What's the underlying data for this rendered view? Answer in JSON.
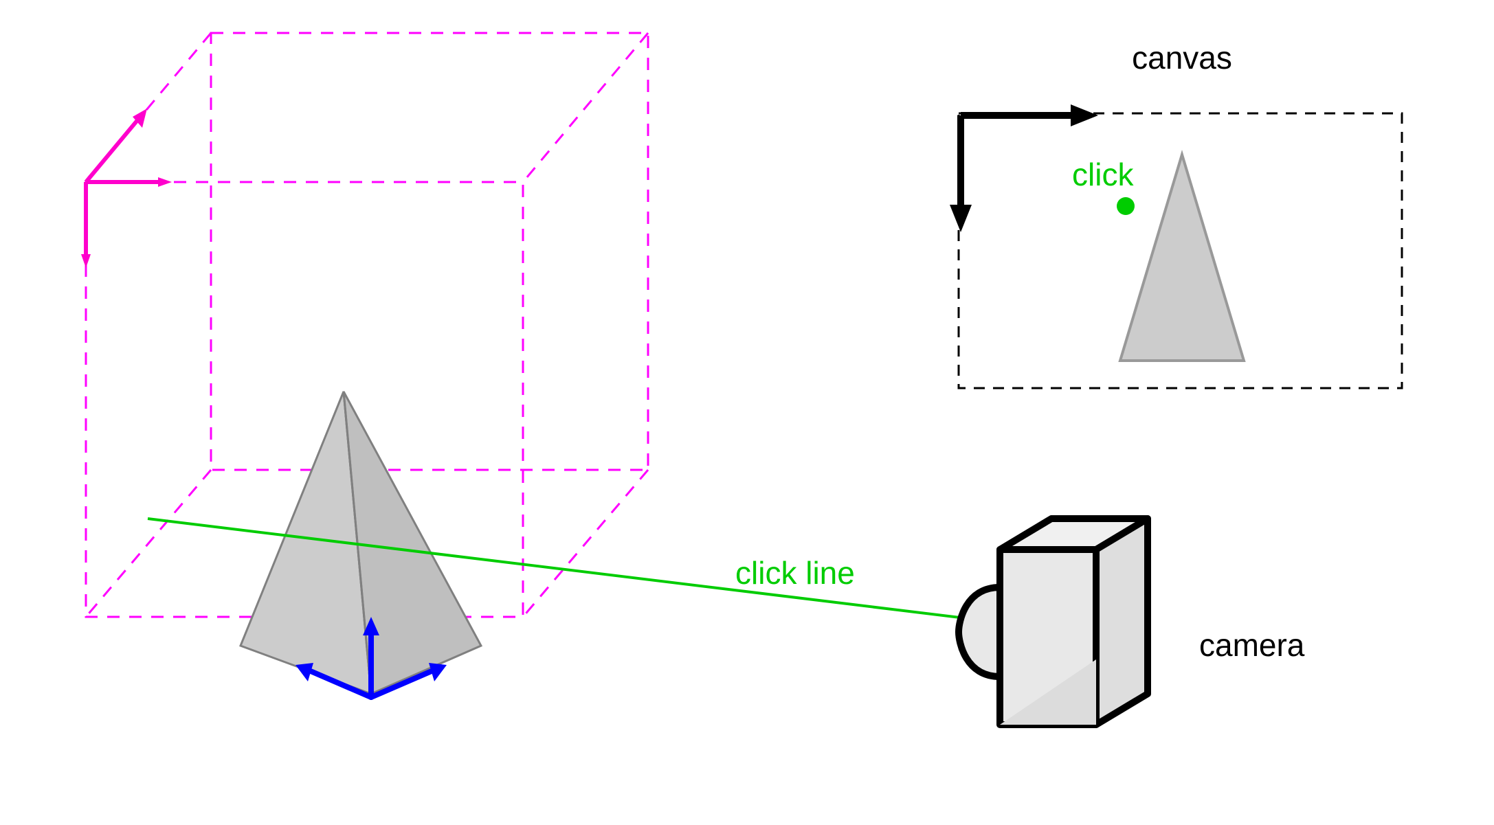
{
  "labels": {
    "canvas": "canvas",
    "click": "click",
    "click_line": "click line",
    "camera": "camera"
  },
  "colors": {
    "cube": "#ff00ff",
    "cube_axes": "#ff00cc",
    "scene_axes": "#0000ff",
    "ray": "#00cc00",
    "click_dot": "#00cc00",
    "pyramid_fill": "#cccccc",
    "pyramid_stroke": "#808080",
    "camera_fill": "#e8e8e8",
    "camera_stroke": "#000000",
    "canvas_stroke": "#000000"
  },
  "diagram": {
    "description": "3D scene bounding cube (magenta, dashed) containing a gray pyramid with blue origin axes at its base. A camera on the right casts a green ray (click line) through the scene. A 2D canvas panel top-right shows the projected pyramid and the green click point, with black canvas-coordinate arrows.",
    "cube": {
      "dashed": true
    },
    "camera": {
      "shape": "box-with-lens"
    },
    "canvas_panel": {
      "dashed": true,
      "arrows": "top-left origin, x-right, y-down"
    }
  }
}
